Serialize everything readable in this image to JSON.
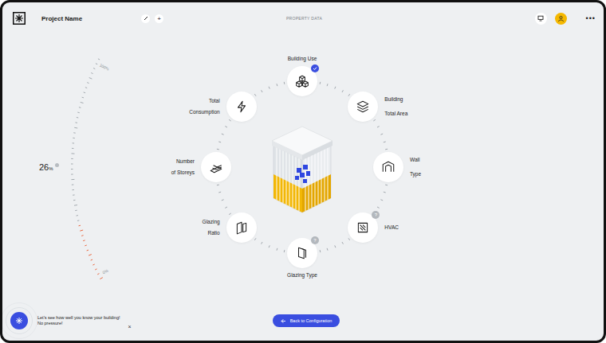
{
  "header": {
    "project_name": "Project Name",
    "add_label": "+",
    "section_title": "PROPERTY DATA",
    "menu_label": "•••"
  },
  "progress": {
    "value": "26",
    "unit": "%",
    "level": 0.26,
    "max_label": "100%",
    "min_label": "0%"
  },
  "nodes": [
    {
      "label_lines": [
        "Building Use"
      ],
      "done": true,
      "badge": ""
    },
    {
      "label_lines": [
        "Building",
        "Total Area"
      ],
      "done": false,
      "badge": ""
    },
    {
      "label_lines": [
        "Wall",
        "Type"
      ],
      "done": false,
      "badge": ""
    },
    {
      "label_lines": [
        "HVAC"
      ],
      "done": false,
      "badge": "?"
    },
    {
      "label_lines": [
        "Glazing Type"
      ],
      "done": false,
      "badge": "?"
    },
    {
      "label_lines": [
        "Glazing",
        "Ratio"
      ],
      "done": false,
      "badge": ""
    },
    {
      "label_lines": [
        "Number",
        "of Storeys"
      ],
      "done": false,
      "badge": ""
    },
    {
      "label_lines": [
        "Total",
        "Consumption"
      ],
      "done": false,
      "badge": ""
    }
  ],
  "assistant": {
    "message_lines": [
      "Let's see how well you know your building!",
      "No pressure!"
    ],
    "close_label": "×"
  },
  "back_button": {
    "label": "Back to Configuration"
  }
}
